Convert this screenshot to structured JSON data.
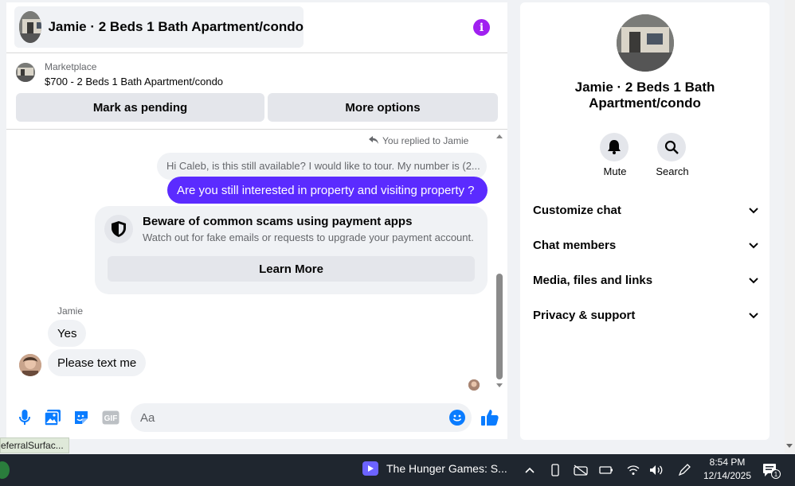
{
  "chat": {
    "title": "Jamie · 2 Beds 1 Bath Apartment/condo",
    "marketplace_label": "Marketplace",
    "listing": "$700 - 2 Beds 1 Bath Apartment/condo",
    "mark_pending_label": "Mark as pending",
    "more_options_label": "More options"
  },
  "messages": {
    "replied_label": "You replied to Jamie",
    "quoted_text": "Hi Caleb, is this still available? I would like to tour. My number is (2...",
    "outgoing_text": "Are you still interested in property and visiting property ?",
    "scam_title": "Beware of common scams using payment apps",
    "scam_text": "Watch out for fake emails or requests to upgrade your payment account.",
    "learn_more_label": "Learn More",
    "sender_name": "Jamie",
    "incoming": [
      "Yes",
      "Please text me"
    ]
  },
  "composer": {
    "placeholder": "Aa",
    "gif_label": "GIF"
  },
  "side": {
    "title": "Jamie · 2 Beds 1 Bath Apartment/condo",
    "mute_label": "Mute",
    "search_label": "Search",
    "sections": [
      "Customize chat",
      "Chat members",
      "Media, files and links",
      "Privacy & support"
    ]
  },
  "status_tooltip": "eferralSurfac...",
  "taskbar": {
    "app_title": "The Hunger Games: S...",
    "time": "8:54 PM",
    "date": "12/14/2025",
    "notification_count": "1"
  },
  "colors": {
    "accent_purple": "#5b2bff",
    "info_purple": "#a020f0",
    "messenger_blue": "#0a7cff",
    "bubble_gray": "#f0f2f5",
    "taskbar": "#1f262f"
  },
  "icons": [
    "info-icon",
    "reply-arrow-icon",
    "shield-icon",
    "microphone-icon",
    "photo-icon",
    "sticker-icon",
    "gif-icon",
    "emoji-icon",
    "thumbs-up-icon",
    "bell-icon",
    "search-icon",
    "chevron-down-icon"
  ]
}
